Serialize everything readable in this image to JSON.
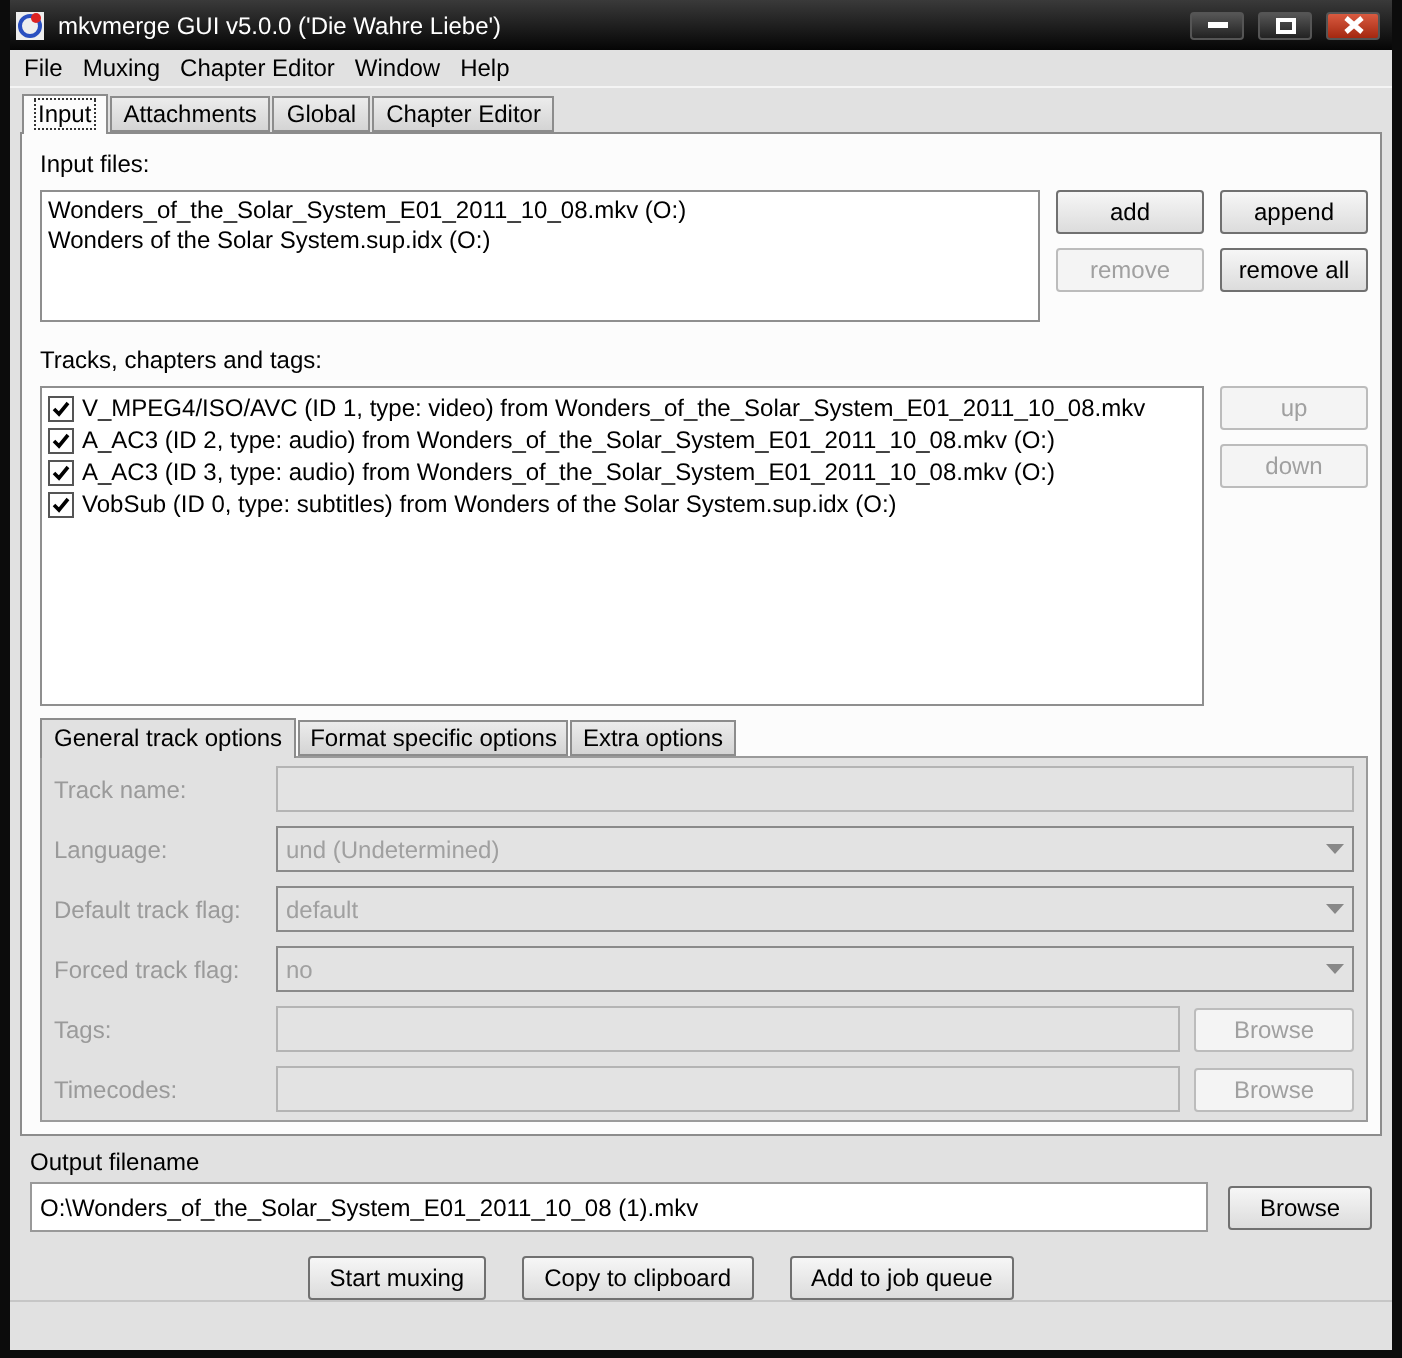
{
  "window": {
    "title": "mkvmerge GUI v5.0.0 ('Die Wahre Liebe')"
  },
  "menu": [
    "File",
    "Muxing",
    "Chapter Editor",
    "Window",
    "Help"
  ],
  "tabs": [
    {
      "label": "Input",
      "selected": true
    },
    {
      "label": "Attachments",
      "selected": false
    },
    {
      "label": "Global",
      "selected": false
    },
    {
      "label": "Chapter Editor",
      "selected": false
    }
  ],
  "input_files": {
    "label": "Input files:",
    "files": [
      "Wonders_of_the_Solar_System_E01_2011_10_08.mkv (O:)",
      "Wonders of the Solar System.sup.idx (O:)"
    ],
    "buttons": [
      {
        "label": "add",
        "disabled": false
      },
      {
        "label": "append",
        "disabled": false
      },
      {
        "label": "remove",
        "disabled": true
      },
      {
        "label": "remove all",
        "disabled": false
      }
    ]
  },
  "tracks": {
    "label": "Tracks, chapters and tags:",
    "items": [
      {
        "label": "V_MPEG4/ISO/AVC (ID 1, type: video) from Wonders_of_the_Solar_System_E01_2011_10_08.mkv",
        "checked": true
      },
      {
        "label": "A_AC3 (ID 2, type: audio) from Wonders_of_the_Solar_System_E01_2011_10_08.mkv (O:)",
        "checked": true
      },
      {
        "label": "A_AC3 (ID 3, type: audio) from Wonders_of_the_Solar_System_E01_2011_10_08.mkv (O:)",
        "checked": true
      },
      {
        "label": "VobSub (ID 0, type: subtitles) from Wonders of the Solar System.sup.idx (O:)",
        "checked": true
      }
    ],
    "buttons": [
      {
        "label": "up",
        "disabled": true
      },
      {
        "label": "down",
        "disabled": true
      }
    ]
  },
  "track_tabs": [
    {
      "label": "General track options",
      "selected": true
    },
    {
      "label": "Format specific options",
      "selected": false
    },
    {
      "label": "Extra options",
      "selected": false
    }
  ],
  "track_options": [
    {
      "kind": "text",
      "label": "Track name:",
      "disabled": true
    },
    {
      "kind": "select",
      "label": "Language:",
      "value": "und (Undetermined)",
      "disabled": true
    },
    {
      "kind": "select",
      "label": "Default track flag:",
      "value": "default",
      "disabled": true
    },
    {
      "kind": "select",
      "label": "Forced track flag:",
      "value": "no",
      "disabled": true
    },
    {
      "kind": "browse",
      "label": "Tags:",
      "button": "Browse",
      "disabled": true
    },
    {
      "kind": "browse",
      "label": "Timecodes:",
      "button": "Browse",
      "disabled": true
    }
  ],
  "output": {
    "label": "Output filename",
    "value": "O:\\Wonders_of_the_Solar_System_E01_2011_10_08 (1).mkv",
    "button": "Browse"
  },
  "actions": [
    "Start muxing",
    "Copy to clipboard",
    "Add to job queue"
  ]
}
